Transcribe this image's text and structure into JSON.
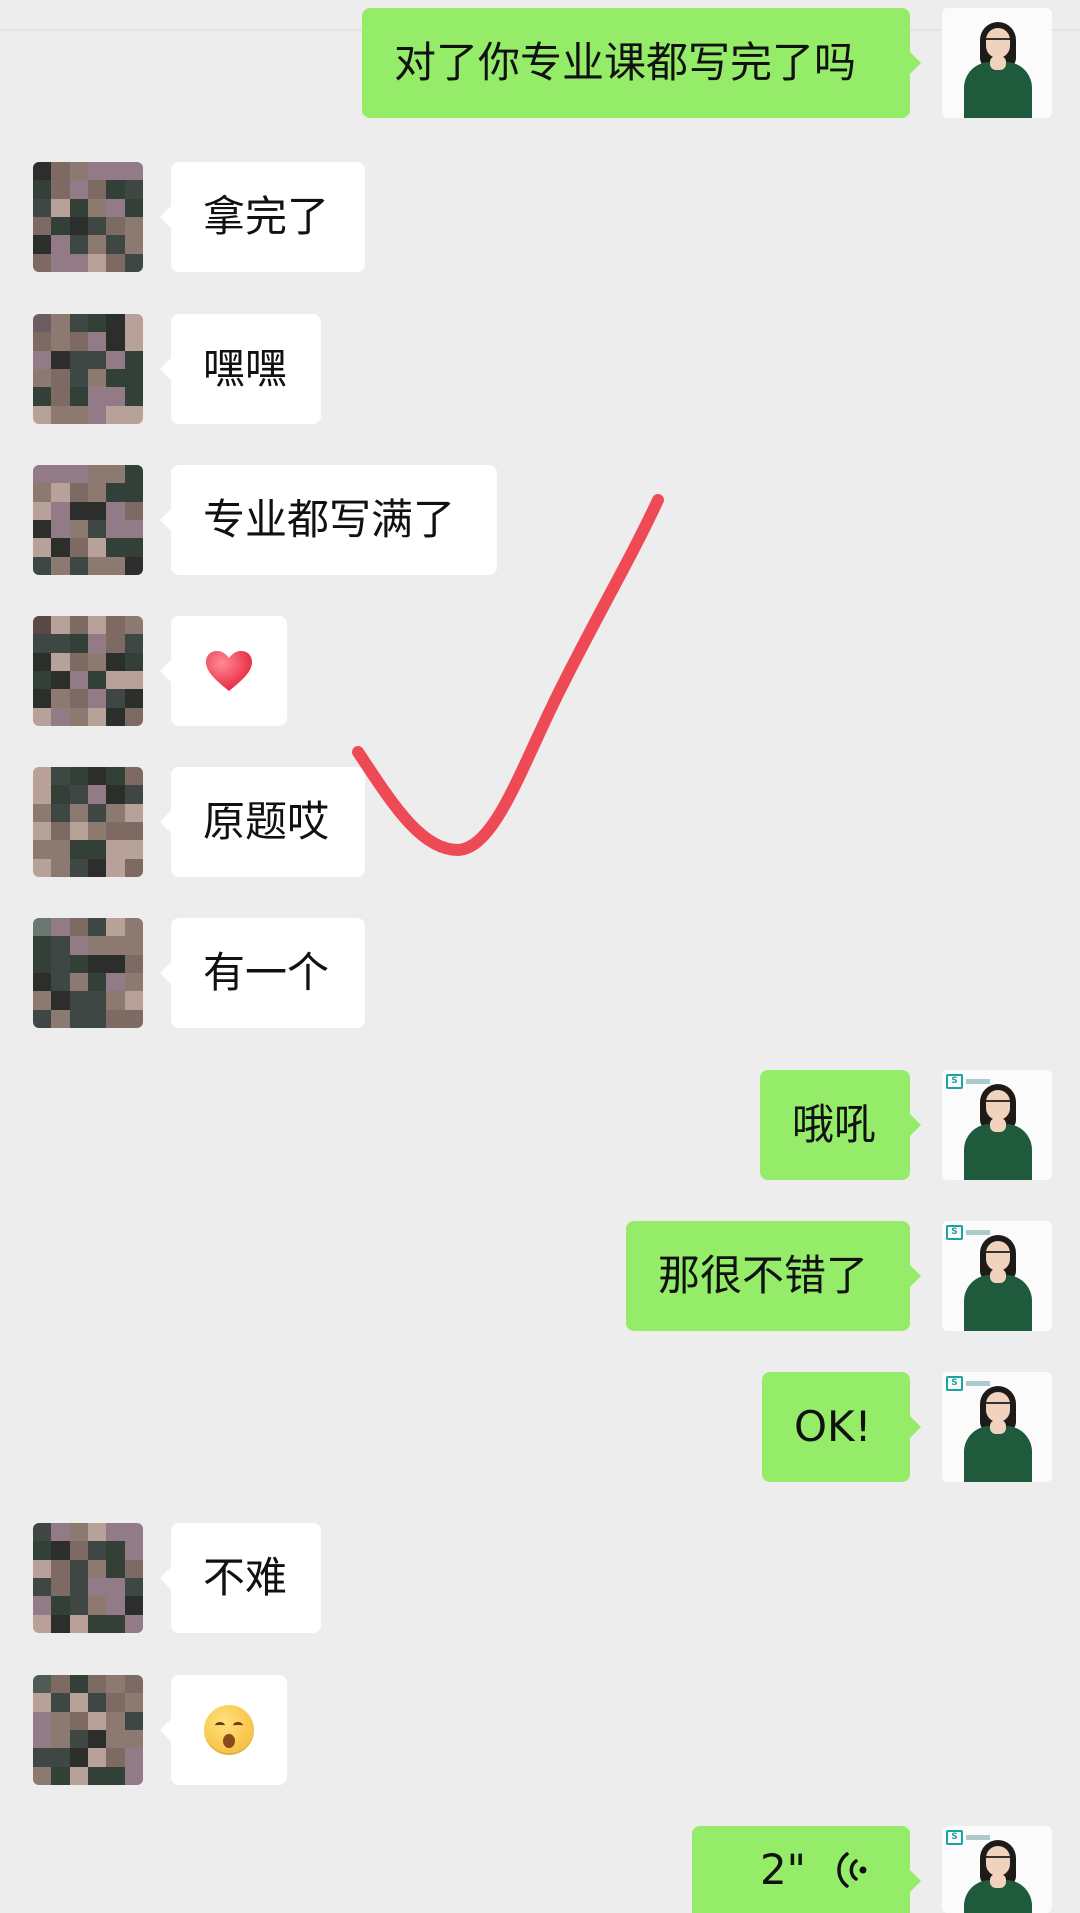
{
  "colors": {
    "background": "#ededed",
    "sent_bubble": "#95ec69",
    "received_bubble": "#ffffff",
    "annotation_check": "#ee4a55",
    "heart": "#f0475c"
  },
  "messages": [
    {
      "side": "right",
      "type": "text",
      "text": "对了你专业课都写完了吗"
    },
    {
      "side": "left",
      "type": "text",
      "text": "拿完了"
    },
    {
      "side": "left",
      "type": "text",
      "text": "嘿嘿"
    },
    {
      "side": "left",
      "type": "text",
      "text": "专业都写满了"
    },
    {
      "side": "left",
      "type": "emoji",
      "icon": "heart-icon"
    },
    {
      "side": "left",
      "type": "text",
      "text": "原题哎"
    },
    {
      "side": "left",
      "type": "text",
      "text": "有一个"
    },
    {
      "side": "right",
      "type": "text",
      "text": "哦吼"
    },
    {
      "side": "right",
      "type": "text",
      "text": "那很不错了"
    },
    {
      "side": "right",
      "type": "text",
      "text": "OK!"
    },
    {
      "side": "left",
      "type": "text",
      "text": "不难"
    },
    {
      "side": "left",
      "type": "emoji",
      "icon": "kissing-face-icon"
    },
    {
      "side": "right",
      "type": "voice",
      "duration": "2\"",
      "icon": "voice-wave-icon"
    }
  ],
  "annotation": {
    "icon": "red-checkmark-icon"
  },
  "avatars": {
    "contact": {
      "icon": "pixelated-avatar-icon"
    },
    "self": {
      "icon": "teacher-avatar-icon"
    }
  }
}
